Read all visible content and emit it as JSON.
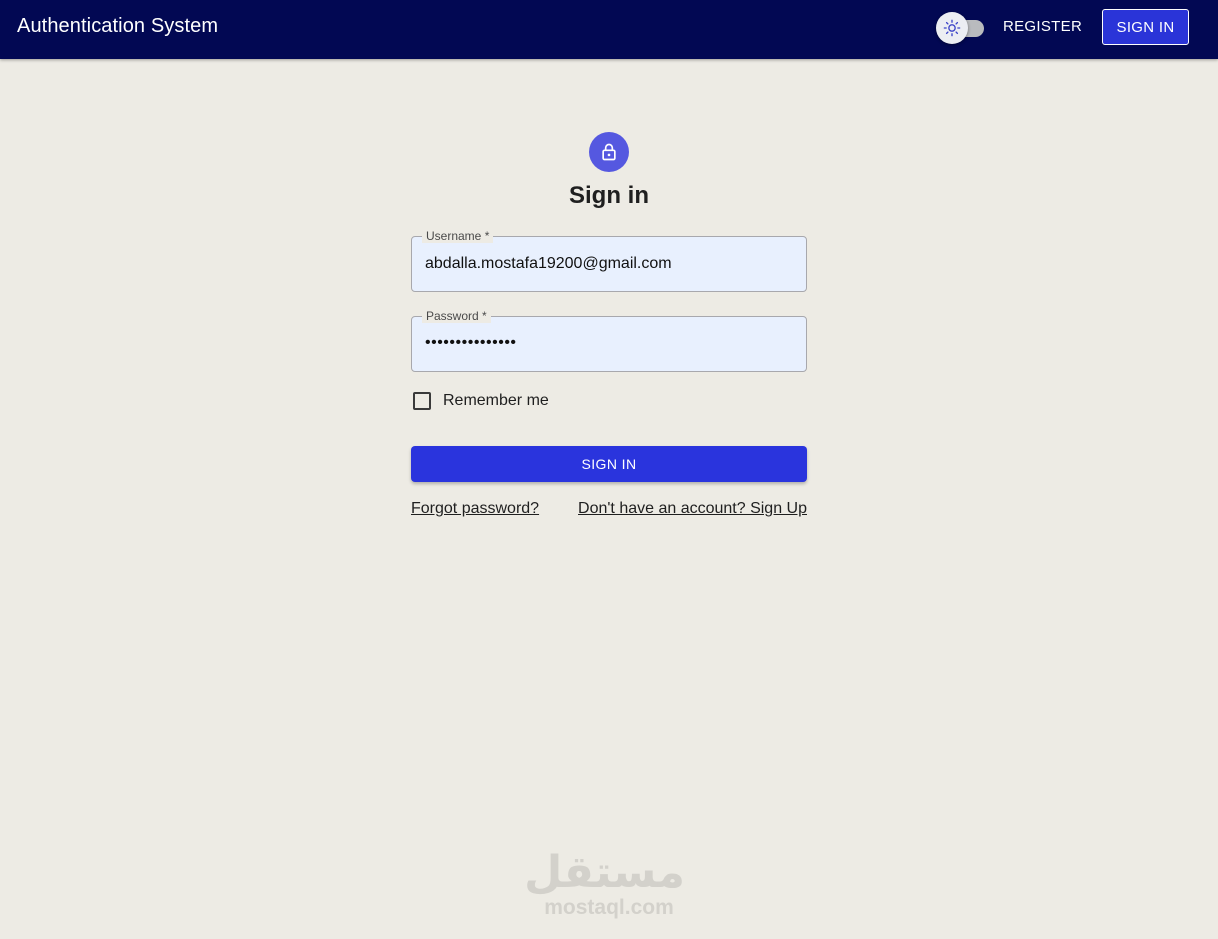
{
  "appbar": {
    "title": "Authentication System",
    "register_label": "REGISTER",
    "signin_label": "SIGN IN",
    "theme_icon": "sun-icon"
  },
  "form": {
    "avatar_icon": "lock-icon",
    "title": "Sign in",
    "username": {
      "label": "Username *",
      "value": "abdalla.mostafa19200@gmail.com"
    },
    "password": {
      "label": "Password *",
      "value": "•••••••••••••••"
    },
    "remember_label": "Remember me",
    "remember_checked": false,
    "submit_label": "SIGN IN",
    "forgot_label": "Forgot password?",
    "signup_label": "Don't have an account? Sign Up"
  },
  "watermark": {
    "logo_text": "مستقل",
    "domain": "mostaql.com"
  },
  "colors": {
    "appbar": "#020853",
    "primary": "#2a34dd",
    "avatar": "#5558e0",
    "background": "#edebe4",
    "field_fill": "#e8f0fe"
  }
}
